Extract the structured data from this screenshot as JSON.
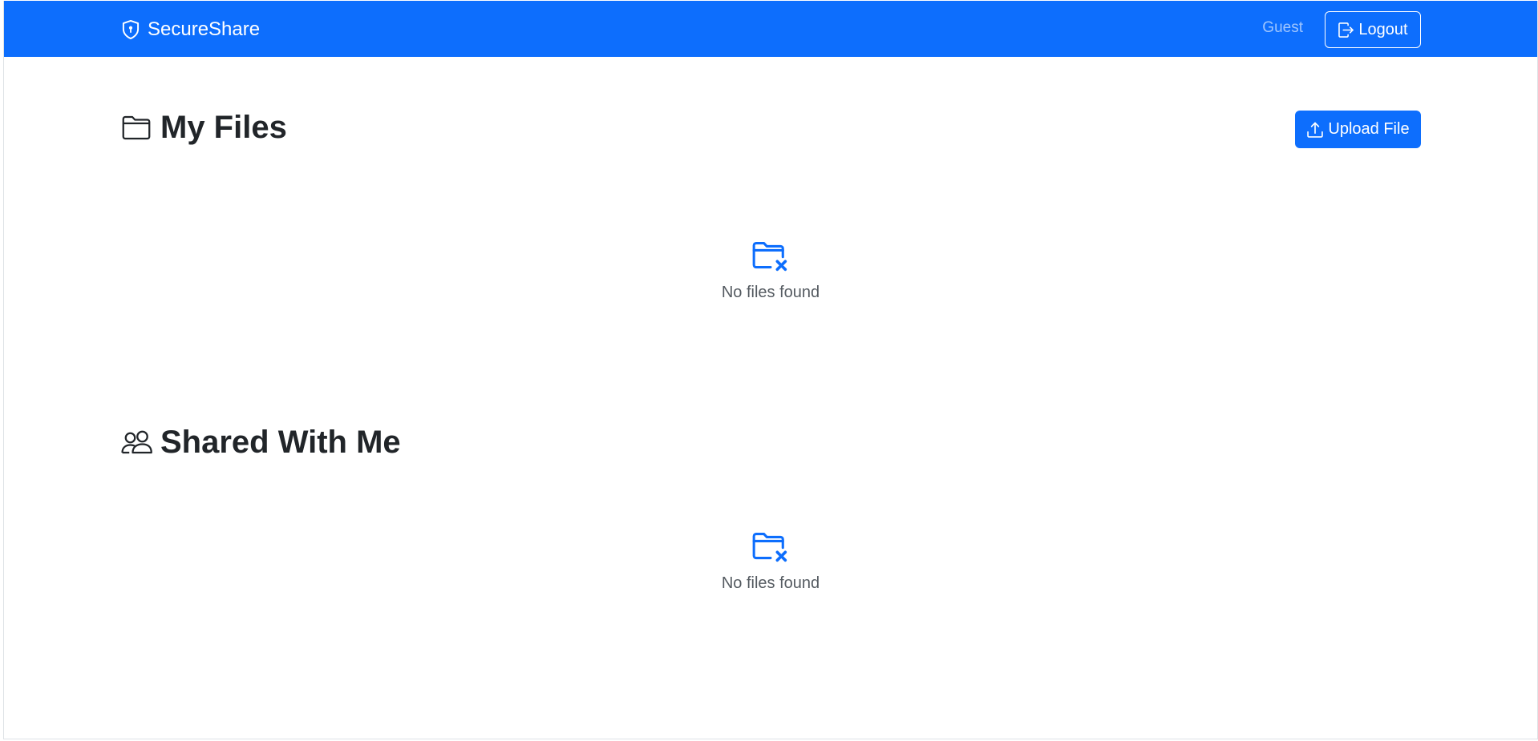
{
  "navbar": {
    "brand": "SecureShare",
    "brand_icon": "shield-lock-icon",
    "user": "Guest",
    "logout_label": "Logout",
    "logout_icon": "box-arrow-right-icon",
    "bg_color": "#0d6efd"
  },
  "my_files": {
    "title": "My Files",
    "title_icon": "folder-icon",
    "upload_label": "Upload File",
    "upload_icon": "upload-icon",
    "empty_icon": "folder-x-icon",
    "empty_message": "No files found"
  },
  "shared": {
    "title": "Shared With Me",
    "title_icon": "people-icon",
    "empty_icon": "folder-x-icon",
    "empty_message": "No files found"
  },
  "colors": {
    "primary": "#0d6efd",
    "text": "#212529",
    "muted": "#555b61"
  }
}
